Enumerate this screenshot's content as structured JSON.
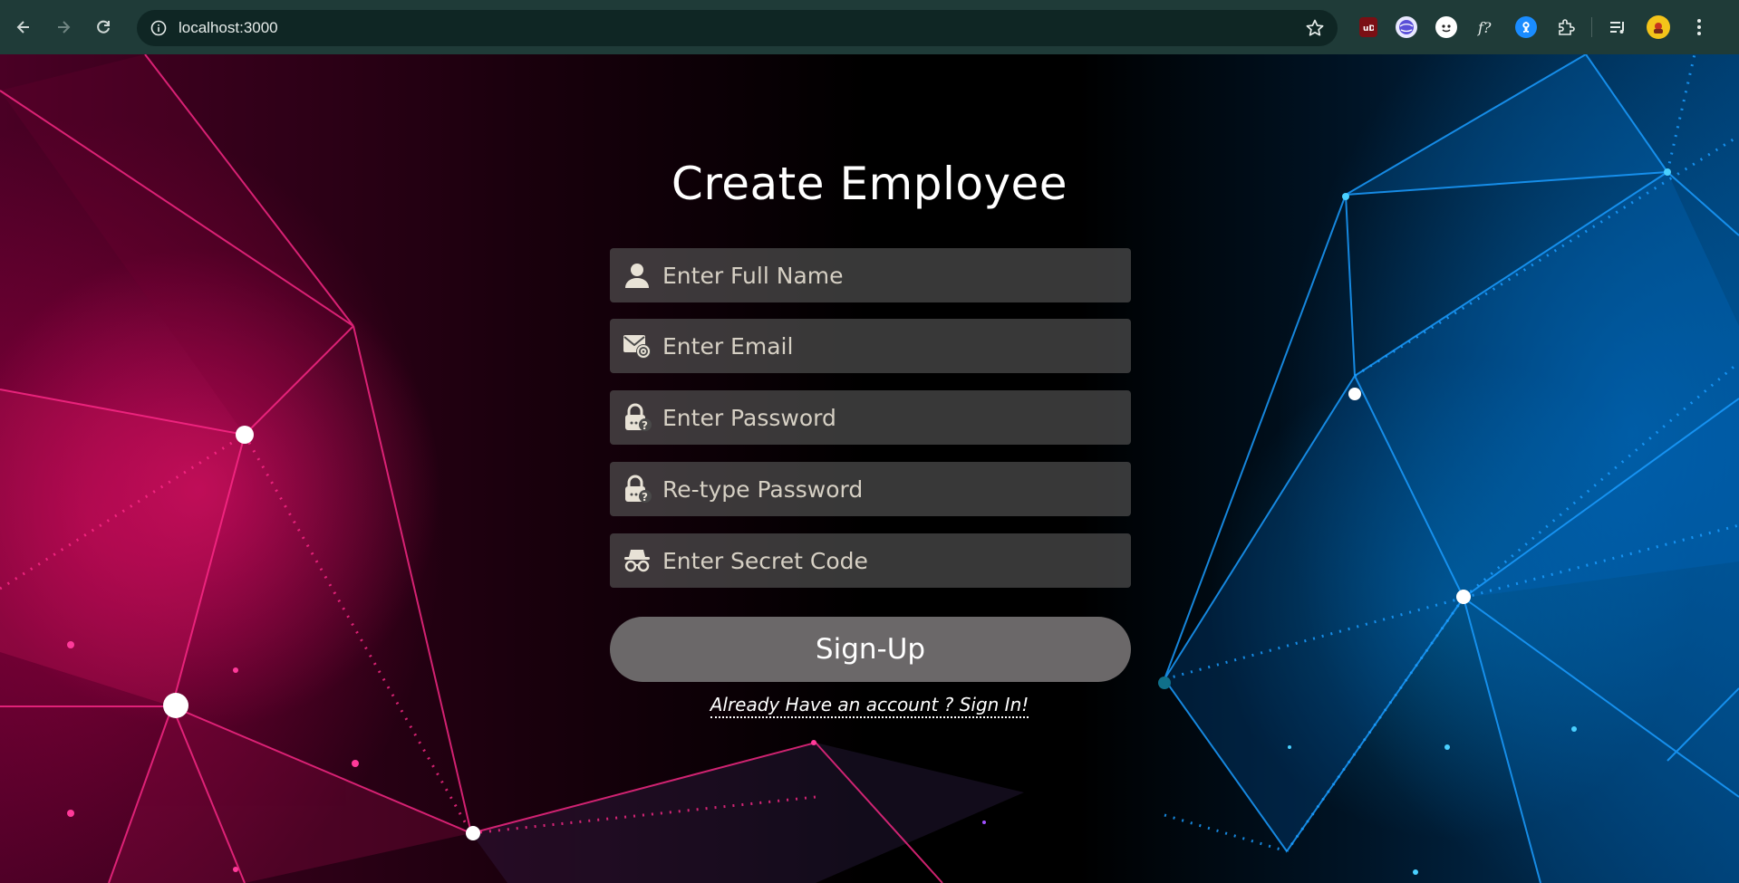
{
  "browser": {
    "url": "localhost:3000",
    "back_icon": "arrow-left-icon",
    "forward_icon": "arrow-right-icon",
    "reload_icon": "reload-icon",
    "extensions": [
      "ublock-icon",
      "globe-extension-icon",
      "avatar-extension-icon",
      "font-finder-icon",
      "shazam-icon",
      "puzzle-icon",
      "media-queue-icon",
      "profile-avatar",
      "menu-dots-icon"
    ]
  },
  "form": {
    "title": "Create Employee",
    "fields": [
      {
        "placeholder": "Enter Full Name",
        "icon": "user-icon"
      },
      {
        "placeholder": "Enter Email",
        "icon": "email-icon"
      },
      {
        "placeholder": "Enter Password",
        "icon": "lock-icon"
      },
      {
        "placeholder": "Re-type Password",
        "icon": "lock-icon"
      },
      {
        "placeholder": "Enter Secret Code",
        "icon": "spy-icon"
      }
    ],
    "submit_label": "Sign-Up",
    "signin_text": "Already Have an account ? Sign In!"
  },
  "colors": {
    "chrome": "#1f3b38",
    "field_bg": "#5a5a5a",
    "button_bg": "#6b6869",
    "accent_pink": "#ff1a80",
    "accent_blue": "#1a9cff"
  }
}
